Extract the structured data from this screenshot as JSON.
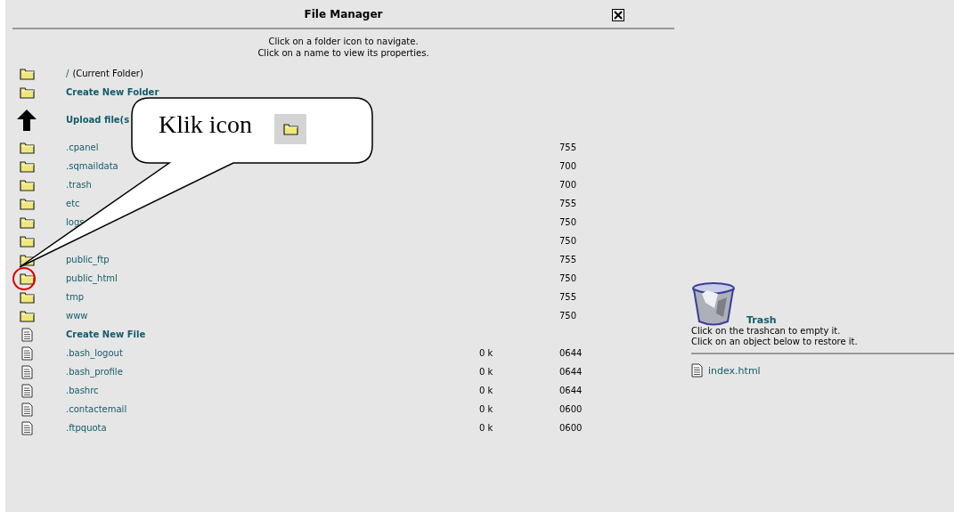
{
  "window": {
    "title": "File Manager"
  },
  "instructions": [
    "Click on a folder icon to navigate.",
    "Click on a name to view its properties."
  ],
  "rows": [
    {
      "kind": "folder",
      "name": "/",
      "note": "(Current Folder)",
      "highlighted": false
    },
    {
      "kind": "create-folder",
      "name": "Create New Folder",
      "highlighted": false
    },
    {
      "kind": "upload",
      "name": "Upload file(s",
      "highlighted": false
    },
    {
      "kind": "folder",
      "name": ".cpanel",
      "perms": "755",
      "highlighted": false
    },
    {
      "kind": "folder",
      "name": ".sqmaildata",
      "perms": "700",
      "highlighted": false
    },
    {
      "kind": "folder",
      "name": ".trash",
      "perms": "700",
      "highlighted": false
    },
    {
      "kind": "folder",
      "name": "etc",
      "perms": "755",
      "highlighted": false
    },
    {
      "kind": "folder",
      "name": "logs",
      "perms": "750",
      "highlighted": false
    },
    {
      "kind": "folder",
      "perms": "750",
      "highlighted": false
    },
    {
      "kind": "folder",
      "name": "public_ftp",
      "perms": "755",
      "highlighted": false
    },
    {
      "kind": "folder",
      "name": "public_html",
      "perms": "750",
      "highlighted": true
    },
    {
      "kind": "folder",
      "name": "tmp",
      "perms": "755",
      "highlighted": false
    },
    {
      "kind": "folder",
      "name": "www",
      "perms": "750",
      "highlighted": false
    },
    {
      "kind": "create-file",
      "name": "Create New File",
      "highlighted": false
    },
    {
      "kind": "file",
      "name": ".bash_logout",
      "size": "0 k",
      "perms": "0644",
      "highlighted": false
    },
    {
      "kind": "file",
      "name": ".bash_profile",
      "size": "0 k",
      "perms": "0644",
      "highlighted": false
    },
    {
      "kind": "file",
      "name": ".bashrc",
      "size": "0 k",
      "perms": "0644",
      "highlighted": false
    },
    {
      "kind": "file",
      "name": ".contactemail",
      "size": "0 k",
      "perms": "0600",
      "highlighted": false
    },
    {
      "kind": "file",
      "name": ".ftpquota",
      "size": "0 k",
      "perms": "0600",
      "highlighted": false
    }
  ],
  "trash": {
    "title": "Trash",
    "lines": [
      "Click on the trashcan to empty it.",
      "Click on an object below to restore it."
    ],
    "items": [
      {
        "name": "index.html"
      }
    ]
  },
  "callout": {
    "text": "Klik icon"
  }
}
